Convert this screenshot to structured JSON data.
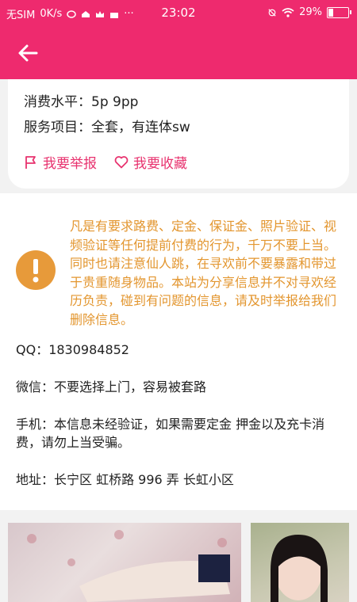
{
  "status_bar": {
    "carrier": "无SIM",
    "speed": "0K/s",
    "time": "23:02",
    "battery": "29%"
  },
  "details": {
    "consumption": "消费水平：5p 9pp",
    "services": "服务项目：全套，有连体sw",
    "report_label": "我要举报",
    "favorite_label": "我要收藏"
  },
  "notice": {
    "warning_text": "凡是有要求路费、定金、保证金、照片验证、视频验证等任何提前付费的行为，千万不要上当。同时也请注意仙人跳，在寻欢前不要暴露和带过于贵重随身物品。本站为分享信息并不对寻欢经历负责，碰到有问题的信息，请及时举报给我们删除信息。",
    "qq": "QQ：1830984852",
    "wechat": "微信：不要选择上门，容易被套路",
    "phone": "手机：本信息未经验证，如果需要定金 押金以及充卡消费，请勿上当受骗。",
    "address": "地址：长宁区 虹桥路 996 弄  长虹小区"
  },
  "colors": {
    "accent": "#ee2a6e",
    "warning": "#e79a3a"
  }
}
